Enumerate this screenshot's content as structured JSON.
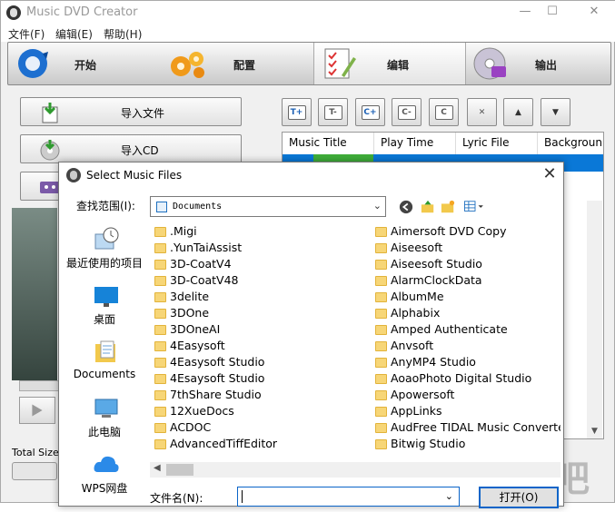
{
  "app": {
    "title": "Music DVD Creator",
    "minimize": "—",
    "maximize": "☐",
    "close": "✕"
  },
  "menu": {
    "items": [
      "文件(F)",
      "编辑(E)",
      "帮助(H)"
    ]
  },
  "toolbar": {
    "tabs": [
      {
        "label": "开始",
        "icon": "refresh-icon"
      },
      {
        "label": "配置",
        "icon": "gears-icon"
      },
      {
        "label": "编辑",
        "icon": "checklist-edit-icon",
        "active": true
      },
      {
        "label": "输出",
        "icon": "disc-burn-icon"
      }
    ]
  },
  "left_panel": {
    "import_file": "导入文件",
    "import_cd": "导入CD",
    "total_sizes": "Total Sizes"
  },
  "edit_buttons": [
    {
      "name": "add-title",
      "label": "T+"
    },
    {
      "name": "remove-title",
      "label": "T-"
    },
    {
      "name": "add-chapter",
      "label": "C+"
    },
    {
      "name": "remove-chapter",
      "label": "C-"
    },
    {
      "name": "chapter-settings",
      "label": "C"
    },
    {
      "name": "delete",
      "label": "✕"
    },
    {
      "name": "move-up",
      "label": "▲"
    },
    {
      "name": "move-down",
      "label": "▼"
    }
  ],
  "list": {
    "columns": [
      "Music Title",
      "Play Time",
      "Lyric File",
      "Backgroun"
    ]
  },
  "dialog": {
    "title": "Select Music Files",
    "look_in_label": "查找范围(I):",
    "look_in_value": "Documents",
    "places": [
      "最近使用的项目",
      "桌面",
      "Documents",
      "此电脑",
      "WPS网盘"
    ],
    "files_col1": [
      ".Migi",
      ".YunTaiAssist",
      "3D-CoatV4",
      "3D-CoatV48",
      "3delite",
      "3DOne",
      "3DOneAI",
      "4Easysoft",
      "4Easysoft Studio",
      "4Esaysoft Studio",
      "7thShare Studio",
      "12XueDocs",
      "ACDOC",
      "AdvancedTiffEditor"
    ],
    "files_col2": [
      "Aimersoft DVD Copy",
      "Aiseesoft",
      "Aiseesoft Studio",
      "AlarmClockData",
      "AlbumMe",
      "Alphabix",
      "Amped Authenticate",
      "Anvsoft",
      "AnyMP4 Studio",
      "AoaoPhoto Digital Studio",
      "Apowersoft",
      "AppLinks",
      "AudFree TIDAL Music Converter",
      "Bitwig Studio"
    ],
    "filename_label": "文件名(N):",
    "filename_value": "",
    "open_button": "打开(O)"
  },
  "watermark": "下载吧"
}
